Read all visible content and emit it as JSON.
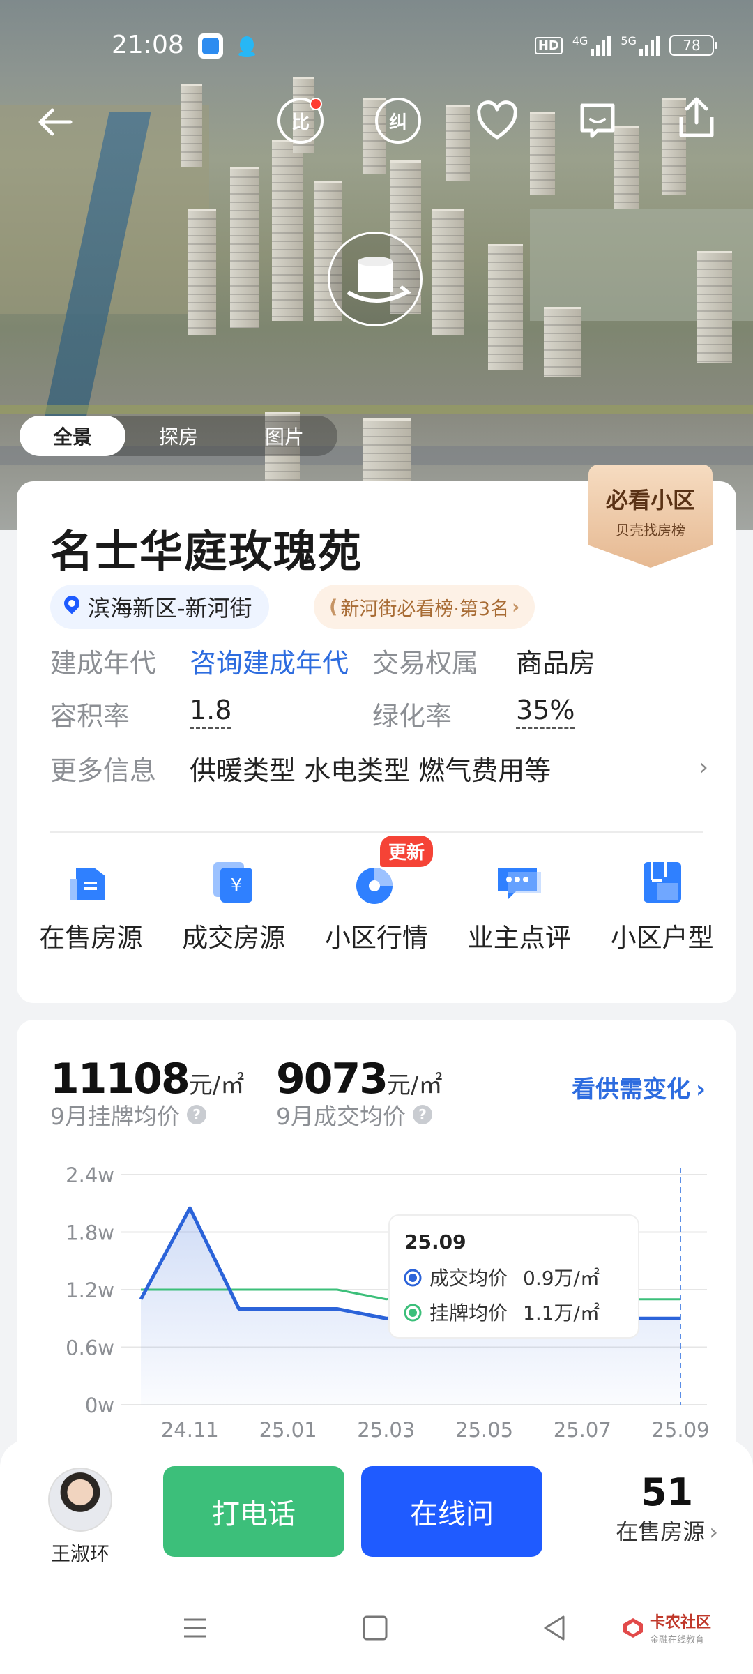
{
  "status": {
    "time": "21:08",
    "battery": "78",
    "hd": "HD",
    "net1": "4G",
    "net2": "5G"
  },
  "topbar": {
    "compare_label": "比",
    "correct_label": "纠"
  },
  "hero_tabs": [
    "全景",
    "探房",
    "图片"
  ],
  "community": {
    "name": "名士华庭玫瑰苑",
    "ribbon_title": "必看小区",
    "ribbon_sub": "贝壳找房榜",
    "location": "滨海新区-新河街",
    "rank_tag": "新河街必看榜·第3名"
  },
  "details": [
    {
      "label": "建成年代",
      "value": "咨询建成年代",
      "label2": "交易权属",
      "value2": "商品房"
    },
    {
      "label": "容积率",
      "value": "1.8",
      "label2": "绿化率",
      "value2": "35%"
    },
    {
      "label": "更多信息",
      "value": "供暖类型 水电类型 燃气费用等"
    }
  ],
  "features": [
    {
      "label": "在售房源",
      "icon": "for-sale-icon"
    },
    {
      "label": "成交房源",
      "icon": "deal-icon",
      "glyph": "¥"
    },
    {
      "label": "小区行情",
      "icon": "market-icon",
      "badge": "更新"
    },
    {
      "label": "业主点评",
      "icon": "review-icon"
    },
    {
      "label": "小区户型",
      "icon": "floorplan-icon"
    }
  ],
  "prices": {
    "listing_value": "11108",
    "listing_unit": "元/㎡",
    "listing_label": "9月挂牌均价",
    "deal_value": "9073",
    "deal_unit": "元/㎡",
    "deal_label": "9月成交均价",
    "supply_link": "看供需变化",
    "q": "?"
  },
  "chart_data": {
    "type": "line",
    "y_ticks": [
      "2.4w",
      "1.8w",
      "1.2w",
      "0.6w",
      "0w"
    ],
    "ylim": [
      0,
      2.4
    ],
    "x_ticks": [
      "24.11",
      "25.01",
      "25.03",
      "25.05",
      "25.07",
      "25.09"
    ],
    "x": [
      "24.10",
      "24.11",
      "24.12",
      "25.01",
      "25.02",
      "25.03",
      "25.04",
      "25.05",
      "25.06",
      "25.07",
      "25.08",
      "25.09"
    ],
    "series": [
      {
        "name": "成交均价",
        "color": "#2b63d9",
        "values": [
          1.1,
          2.05,
          1.0,
          1.0,
          1.0,
          0.9,
          0.9,
          0.9,
          0.9,
          0.9,
          0.9,
          0.9
        ]
      },
      {
        "name": "挂牌均价",
        "color": "#3cbf7a",
        "values": [
          1.2,
          1.2,
          1.2,
          1.2,
          1.2,
          1.1,
          1.15,
          1.15,
          1.1,
          1.1,
          1.1,
          1.1
        ]
      }
    ],
    "tooltip": {
      "title": "25.09",
      "rows": [
        {
          "name": "成交均价",
          "value": "0.9万/㎡",
          "color": "#2b63d9"
        },
        {
          "name": "挂牌均价",
          "value": "1.1万/㎡",
          "color": "#3cbf7a"
        }
      ]
    },
    "grid": true
  },
  "bottom": {
    "agent_name": "王淑环",
    "call_label": "打电话",
    "chat_label": "在线问",
    "sale_count": "51",
    "sale_label": "在售房源"
  },
  "watermark": {
    "name": "卡农社区",
    "sub": "金融在线教育"
  }
}
